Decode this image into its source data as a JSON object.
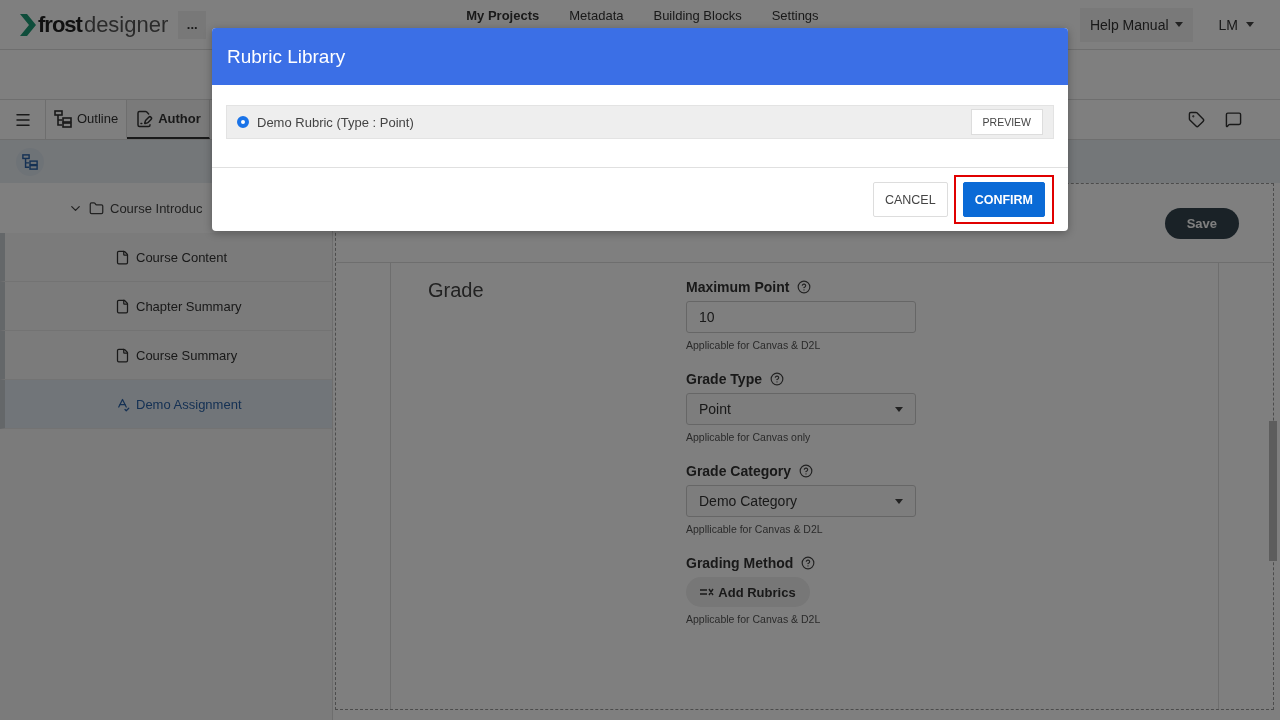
{
  "app": {
    "logo_bold": "frost",
    "logo_light": "designer",
    "more": "...",
    "nav": [
      {
        "label": "My Projects",
        "selected": true
      },
      {
        "label": "Metadata",
        "selected": false
      },
      {
        "label": "Building Blocks",
        "selected": false
      },
      {
        "label": "Settings",
        "selected": false
      }
    ],
    "help_menu": "Help Manual",
    "user_menu": "LM"
  },
  "tabs": [
    {
      "label": "Outline",
      "kind": "outline",
      "selected": false
    },
    {
      "label": "Author",
      "kind": "author",
      "selected": true
    }
  ],
  "tree": {
    "label": "Course Introduc",
    "expanded": true,
    "children": [
      {
        "label": "Course Content",
        "kind": "page",
        "selected": false
      },
      {
        "label": "Chapter Summary",
        "kind": "page",
        "selected": false
      },
      {
        "label": "Course Summary",
        "kind": "page",
        "selected": false
      },
      {
        "label": "Demo Assignment",
        "kind": "assignment",
        "selected": true
      }
    ]
  },
  "save_button": "Save",
  "section": {
    "title": "Grade",
    "fields": [
      {
        "kind": "input",
        "label": "Maximum Point",
        "value": "10",
        "hint": "Applicable for Canvas & D2L"
      },
      {
        "kind": "select",
        "label": "Grade Type",
        "value": "Point",
        "hint": "Applicable for Canvas only"
      },
      {
        "kind": "select",
        "label": "Grade Category",
        "value": "Demo Category",
        "hint": "Appllicable for Canvas & D2L"
      },
      {
        "kind": "button",
        "label": "Grading Method",
        "value": "Add Rubrics",
        "hint": "Applicable for Canvas & D2L"
      }
    ]
  },
  "dialog": {
    "title": "Rubric Library",
    "rubrics": [
      {
        "label": "Demo Rubric (Type : Point)",
        "selected": true,
        "action": "PREVIEW"
      }
    ],
    "buttons": [
      {
        "label": "CANCEL",
        "kind": "secondary",
        "highlighted": false
      },
      {
        "label": "CONFIRM",
        "kind": "primary",
        "highlighted": true
      }
    ]
  }
}
